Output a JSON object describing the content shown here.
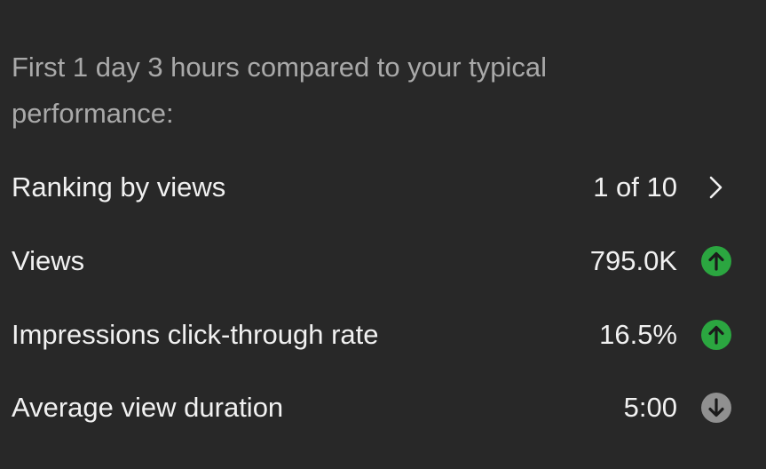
{
  "intro_text": "First 1 day 3 hours compared to your typical performance:",
  "metrics": [
    {
      "label": "Ranking by views",
      "value": "1 of 10",
      "indicator": "chevron-right-icon"
    },
    {
      "label": "Views",
      "value": "795.0K",
      "indicator": "arrow-up-icon",
      "color": "#2ba640"
    },
    {
      "label": "Impressions click-through rate",
      "value": "16.5%",
      "indicator": "arrow-up-icon",
      "color": "#2ba640"
    },
    {
      "label": "Average view duration",
      "value": "5:00",
      "indicator": "arrow-down-icon",
      "color": "#909090"
    }
  ],
  "colors": {
    "background": "#282828",
    "text_primary": "#f1f1f1",
    "text_secondary": "#a9a9a9",
    "positive": "#2ba640",
    "neutral": "#909090"
  }
}
